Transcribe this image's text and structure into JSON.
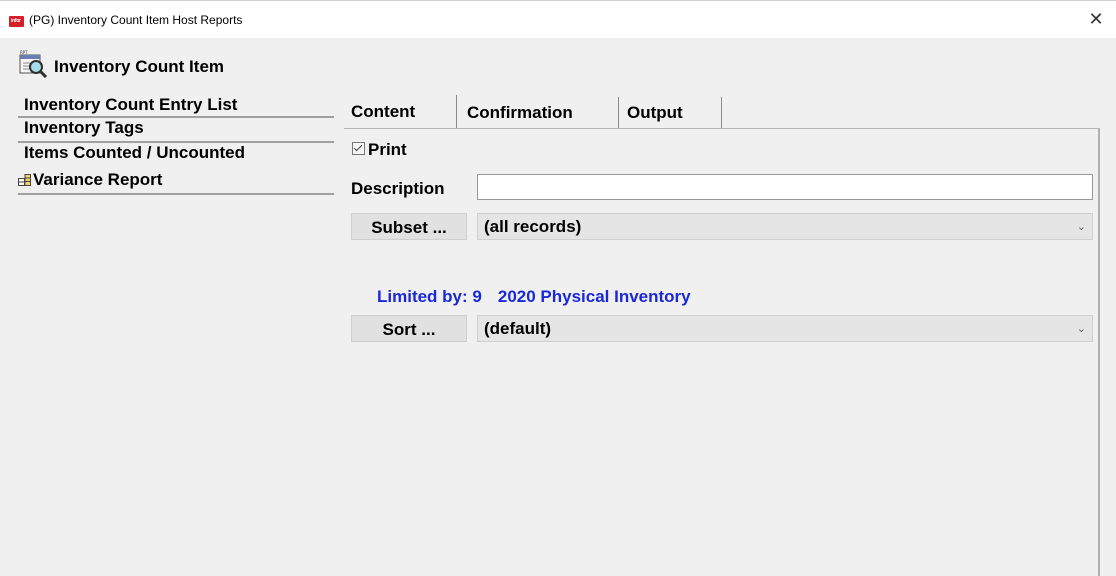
{
  "window": {
    "app_icon_text": "infor",
    "title": "(PG) Inventory Count Item Host Reports",
    "close_glyph": "✕"
  },
  "module": {
    "icon": "report-magnifier-icon",
    "title": "Inventory Count Item"
  },
  "sidebar": {
    "items": [
      {
        "label": "Inventory Count Entry List"
      },
      {
        "label": "Inventory Tags"
      },
      {
        "label": "Items Counted / Uncounted"
      },
      {
        "label": "Variance Report",
        "icon": "report-grid-icon"
      }
    ]
  },
  "tabs": [
    {
      "label": "Content",
      "active": true
    },
    {
      "label": "Confirmation",
      "active": false
    },
    {
      "label": "Output",
      "active": false
    }
  ],
  "content": {
    "print_label": "Print",
    "print_checked": true,
    "description_label": "Description",
    "description_value": "",
    "subset_button": "Subset ...",
    "subset_value": "(all records)",
    "limited_prefix": "Limited by: 9",
    "limited_value": "2020 Physical Inventory",
    "sort_button": "Sort ...",
    "sort_value": "(default)",
    "dropdown_glyph": "⌄"
  },
  "colors": {
    "background": "#f0f0f0",
    "limited_text": "#1a28d8",
    "app_icon": "#d5202a"
  }
}
